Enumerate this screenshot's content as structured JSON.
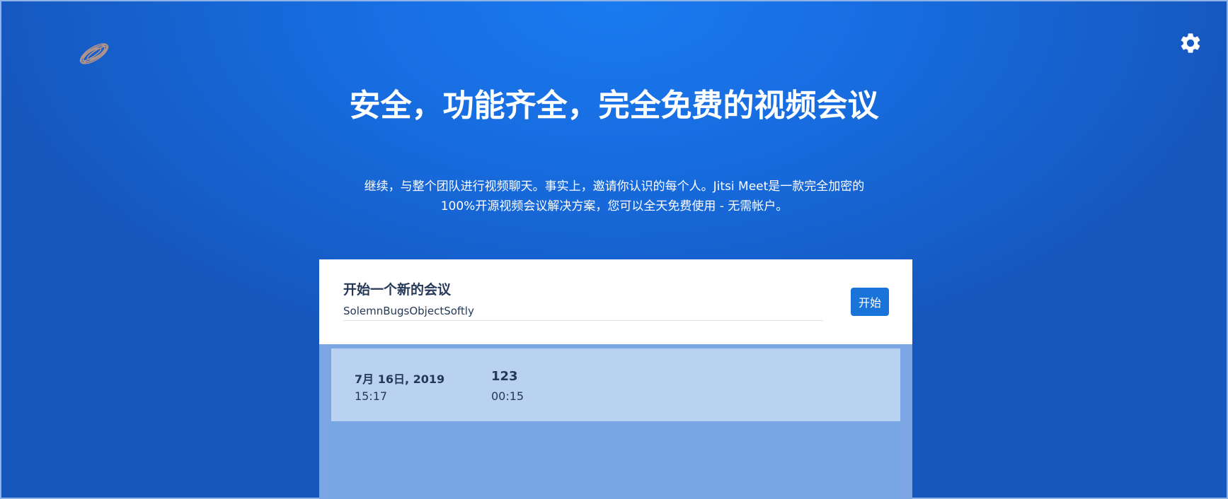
{
  "icons": {
    "logo": "jitsi-logo-icon",
    "settings": "gear-icon"
  },
  "colors": {
    "background": "#176cdf",
    "accent_button": "#1a73d9",
    "card_text": "#253858",
    "recent_row": "#bad2f1",
    "recent_panel": "#77a6e2"
  },
  "hero": {
    "title": "安全，功能齐全，完全免费的视频会议",
    "description": "继续，与整个团队进行视频聊天。事实上，邀请你认识的每个人。Jitsi Meet是一款完全加密的100%开源视频会议解决方案，您可以全天免费使用 - 无需帐户。"
  },
  "new_meeting": {
    "title": "开始一个新的会议",
    "room_name": "SolemnBugsObjectSoftly",
    "go_label": "开始"
  },
  "recent": [
    {
      "date": "7月 16日, 2019",
      "time": "15:17",
      "room": "123",
      "duration": "00:15"
    }
  ]
}
